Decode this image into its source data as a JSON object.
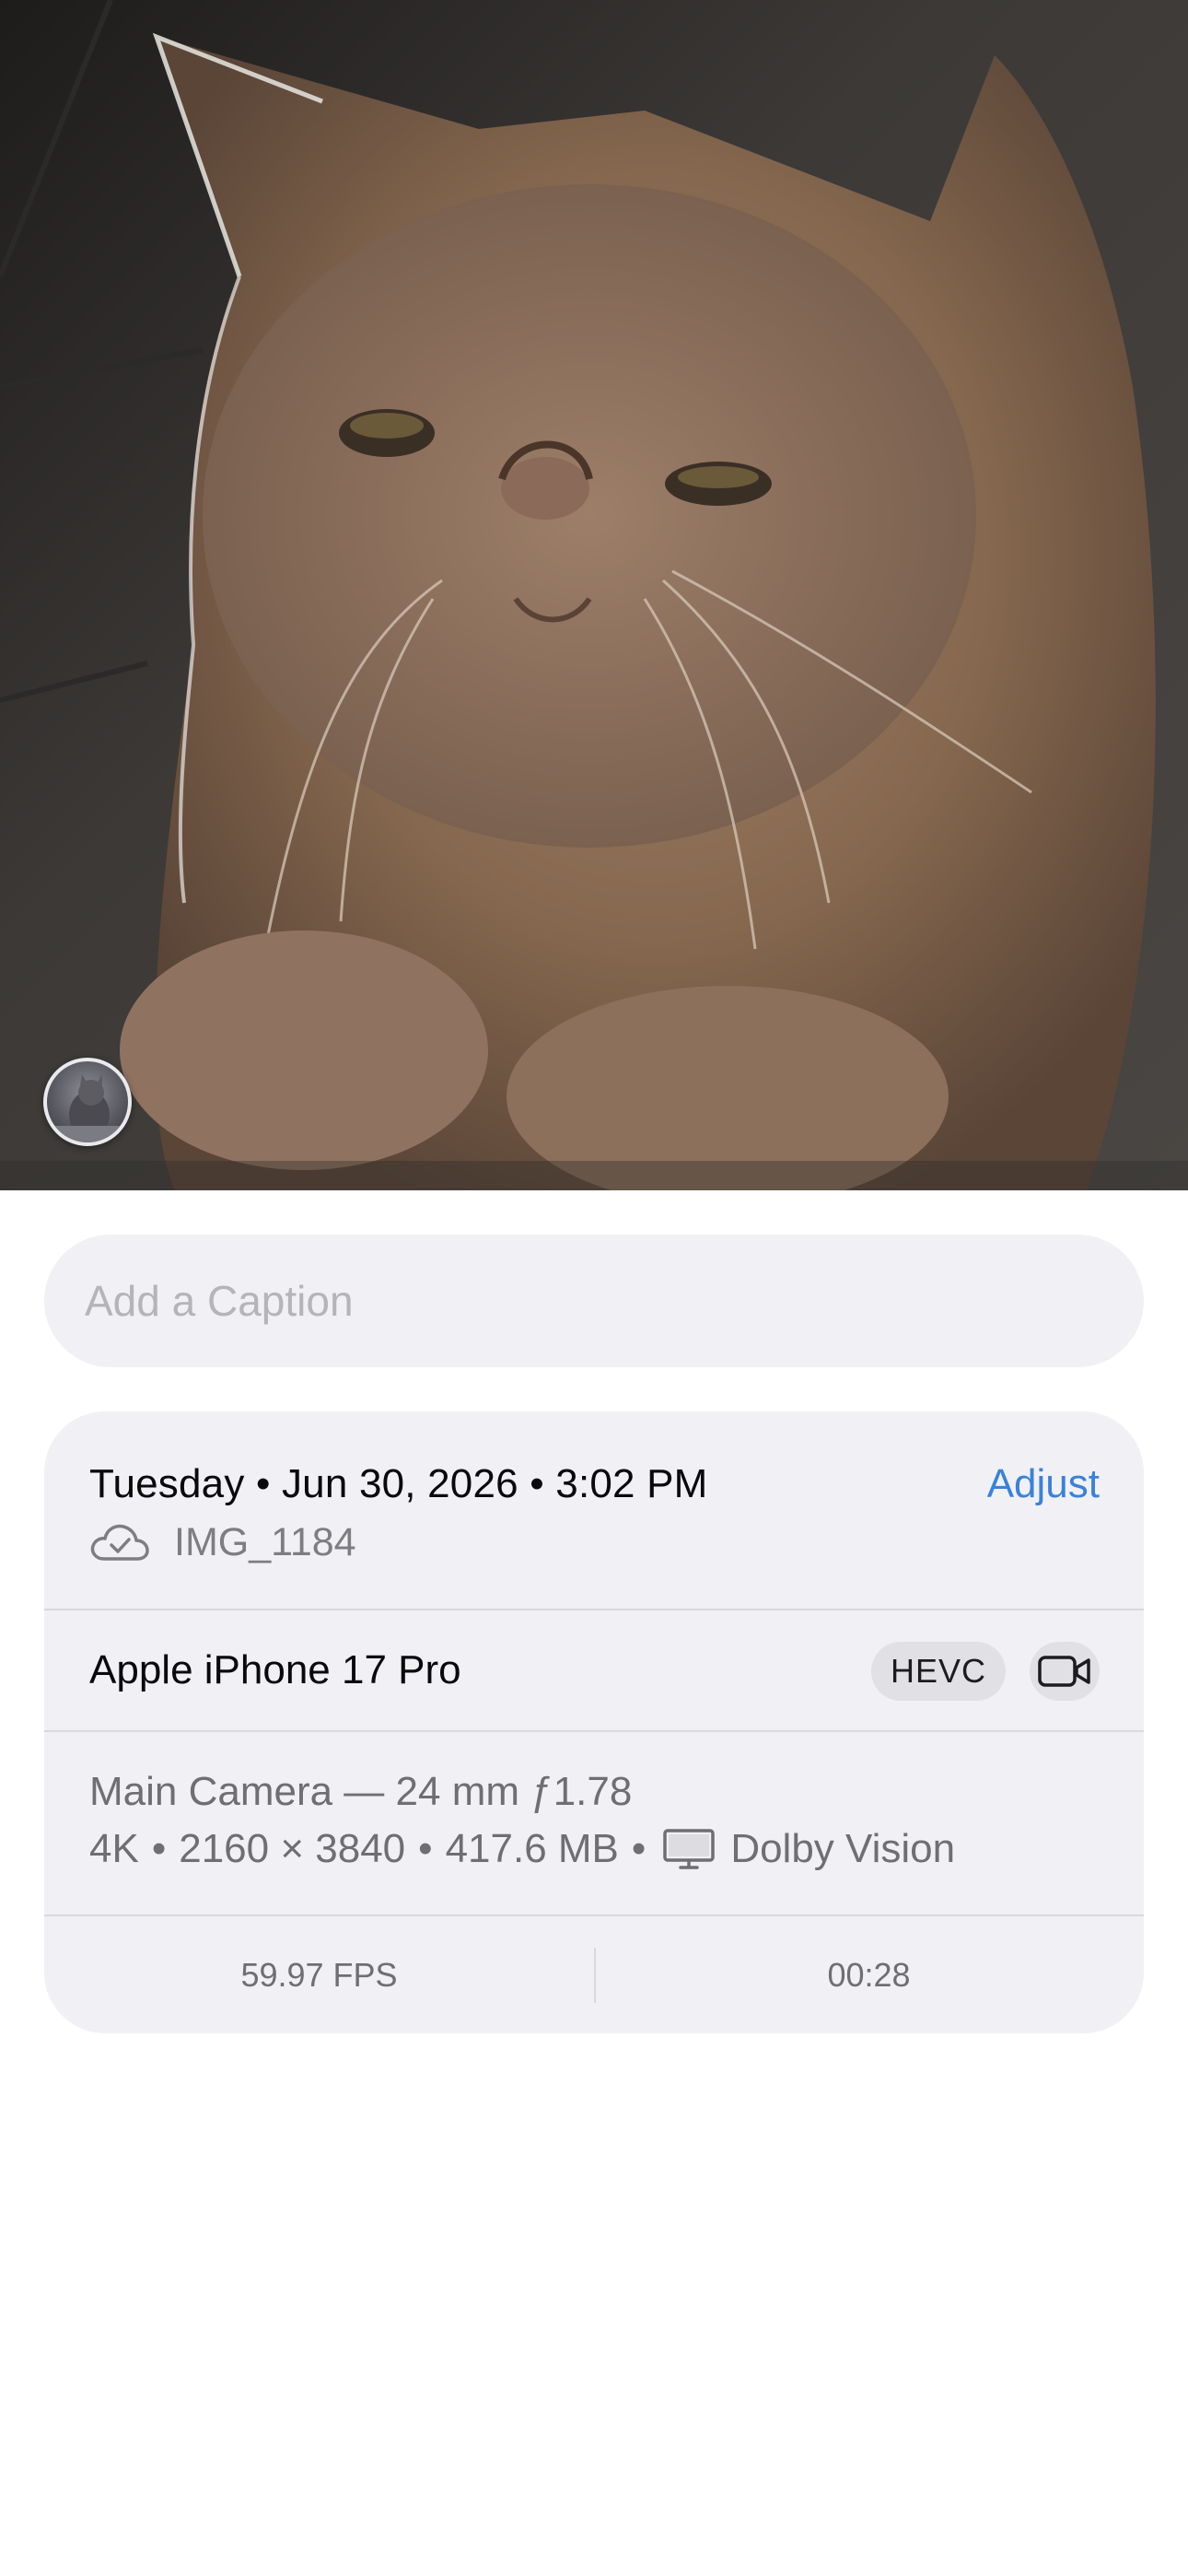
{
  "photo": {
    "description_icon": "cat-photo",
    "subject_badge_icon": "visual-lookup-subject-icon"
  },
  "caption": {
    "placeholder": "Add a Caption",
    "value": ""
  },
  "info": {
    "datetime": "Tuesday • Jun 30, 2026 • 3:02 PM",
    "adjust_label": "Adjust",
    "cloud_icon": "icloud-check-icon",
    "file_name": "IMG_1184",
    "device": "Apple iPhone 17 Pro",
    "format_badge": "HEVC",
    "video_icon": "video-camera-icon",
    "lens": "Main Camera — 24 mm ƒ1.78",
    "resolution": "4K",
    "dimensions": "2160 × 3840",
    "file_size": "417.6 MB",
    "display_icon": "display-icon",
    "hdr": "Dolby Vision",
    "fps": "59.97 FPS",
    "duration": "00:28"
  },
  "colors": {
    "accent": "#3a82d8",
    "card_bg": "#f0f0f5",
    "secondary_text": "#6e6e73"
  }
}
